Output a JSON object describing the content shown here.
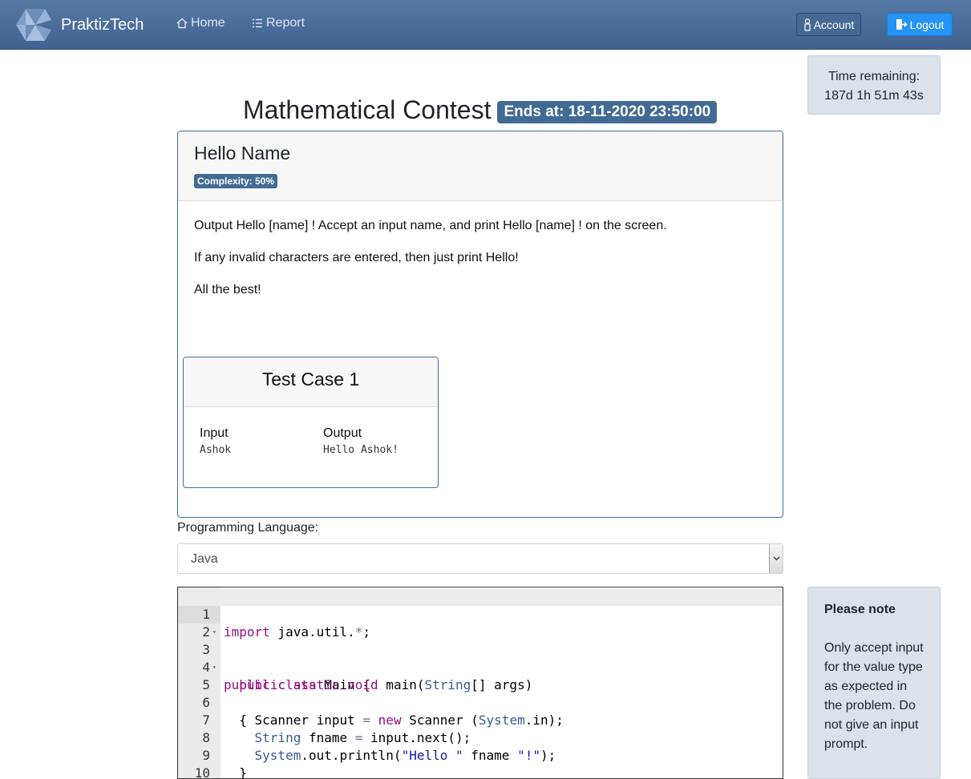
{
  "navbar": {
    "brand": "PraktizTech",
    "home_label": "Home",
    "report_label": "Report",
    "account_label": "Account",
    "logout_label": "Logout"
  },
  "timer": {
    "label": "Time remaining:",
    "value": "187d 1h 51m 43s"
  },
  "contest": {
    "title": "Mathematical Contest",
    "ends_badge": "Ends at: 18-11-2020 23:50:00"
  },
  "problem": {
    "name": "Hello Name",
    "complexity": "Complexity: 50%",
    "description": [
      "Output Hello [name] ! Accept an input name, and print Hello [name] ! on the screen.",
      "If any invalid characters are entered, then just print Hello!",
      "All the best!"
    ],
    "test_case": {
      "title": "Test Case 1",
      "input_label": "Input",
      "input_value": "Ashok",
      "output_label": "Output",
      "output_value": "Hello Ashok!"
    }
  },
  "language": {
    "label": "Programming Language:",
    "selected": "Java"
  },
  "editor": {
    "line_numbers": [
      "1",
      "2",
      "3",
      "4",
      "5",
      "6",
      "7",
      "8",
      "9",
      "10"
    ],
    "lines": [
      "import java.util.*;",
      "",
      "public class Main {",
      "  public static void main(String[] args)",
      "  {",
      "    Scanner input = new Scanner (System.in);",
      "    String fname = input.next();",
      "    System.out.println(\"Hello \" fname \"!\");",
      "  }",
      "}"
    ]
  },
  "note": {
    "title": "Please note",
    "text": "Only accept input for the value type as expected in the problem. Do not give an input prompt."
  }
}
